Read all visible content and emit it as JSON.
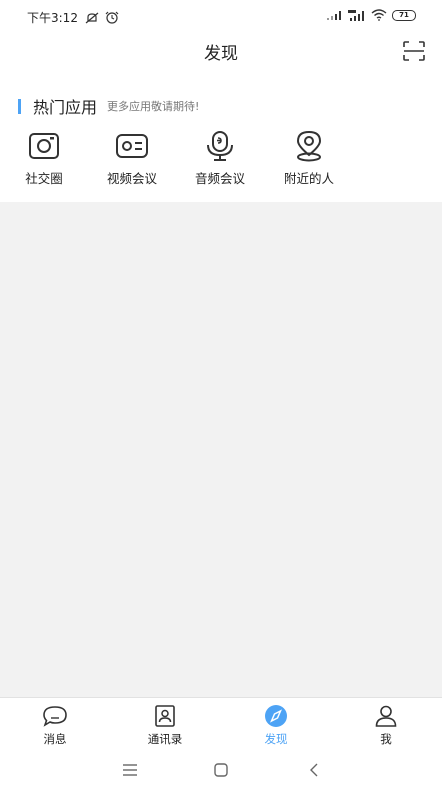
{
  "status_bar": {
    "time": "下午3:12",
    "battery": "71"
  },
  "header": {
    "title": "发现"
  },
  "hot_apps": {
    "title": "热门应用",
    "subtitle": "更多应用敬请期待!",
    "items": [
      {
        "label": "社交圈",
        "icon": "camera-icon"
      },
      {
        "label": "视频会议",
        "icon": "video-meeting-icon"
      },
      {
        "label": "音频会议",
        "icon": "microphone-icon"
      },
      {
        "label": "附近的人",
        "icon": "location-pin-icon"
      }
    ]
  },
  "tabbar": {
    "items": [
      {
        "label": "消息",
        "icon": "chat-bubble-icon"
      },
      {
        "label": "通讯录",
        "icon": "contacts-icon"
      },
      {
        "label": "发现",
        "icon": "compass-icon",
        "active": true
      },
      {
        "label": "我",
        "icon": "person-icon"
      }
    ]
  },
  "colors": {
    "accent": "#4da3f5",
    "background": "#f2f2f2",
    "panel": "#ffffff"
  }
}
